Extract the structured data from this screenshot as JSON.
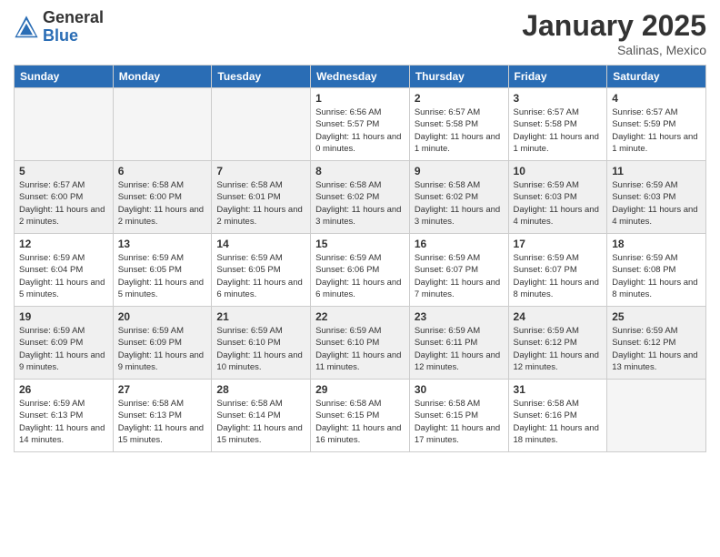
{
  "logo": {
    "general": "General",
    "blue": "Blue"
  },
  "header": {
    "month": "January 2025",
    "location": "Salinas, Mexico"
  },
  "weekdays": [
    "Sunday",
    "Monday",
    "Tuesday",
    "Wednesday",
    "Thursday",
    "Friday",
    "Saturday"
  ],
  "weeks": [
    [
      {
        "day": "",
        "info": "",
        "empty": true
      },
      {
        "day": "",
        "info": "",
        "empty": true
      },
      {
        "day": "",
        "info": "",
        "empty": true
      },
      {
        "day": "1",
        "info": "Sunrise: 6:56 AM\nSunset: 5:57 PM\nDaylight: 11 hours and 0 minutes.",
        "empty": false
      },
      {
        "day": "2",
        "info": "Sunrise: 6:57 AM\nSunset: 5:58 PM\nDaylight: 11 hours and 1 minute.",
        "empty": false
      },
      {
        "day": "3",
        "info": "Sunrise: 6:57 AM\nSunset: 5:58 PM\nDaylight: 11 hours and 1 minute.",
        "empty": false
      },
      {
        "day": "4",
        "info": "Sunrise: 6:57 AM\nSunset: 5:59 PM\nDaylight: 11 hours and 1 minute.",
        "empty": false
      }
    ],
    [
      {
        "day": "5",
        "info": "Sunrise: 6:57 AM\nSunset: 6:00 PM\nDaylight: 11 hours and 2 minutes.",
        "empty": false
      },
      {
        "day": "6",
        "info": "Sunrise: 6:58 AM\nSunset: 6:00 PM\nDaylight: 11 hours and 2 minutes.",
        "empty": false
      },
      {
        "day": "7",
        "info": "Sunrise: 6:58 AM\nSunset: 6:01 PM\nDaylight: 11 hours and 2 minutes.",
        "empty": false
      },
      {
        "day": "8",
        "info": "Sunrise: 6:58 AM\nSunset: 6:02 PM\nDaylight: 11 hours and 3 minutes.",
        "empty": false
      },
      {
        "day": "9",
        "info": "Sunrise: 6:58 AM\nSunset: 6:02 PM\nDaylight: 11 hours and 3 minutes.",
        "empty": false
      },
      {
        "day": "10",
        "info": "Sunrise: 6:59 AM\nSunset: 6:03 PM\nDaylight: 11 hours and 4 minutes.",
        "empty": false
      },
      {
        "day": "11",
        "info": "Sunrise: 6:59 AM\nSunset: 6:03 PM\nDaylight: 11 hours and 4 minutes.",
        "empty": false
      }
    ],
    [
      {
        "day": "12",
        "info": "Sunrise: 6:59 AM\nSunset: 6:04 PM\nDaylight: 11 hours and 5 minutes.",
        "empty": false
      },
      {
        "day": "13",
        "info": "Sunrise: 6:59 AM\nSunset: 6:05 PM\nDaylight: 11 hours and 5 minutes.",
        "empty": false
      },
      {
        "day": "14",
        "info": "Sunrise: 6:59 AM\nSunset: 6:05 PM\nDaylight: 11 hours and 6 minutes.",
        "empty": false
      },
      {
        "day": "15",
        "info": "Sunrise: 6:59 AM\nSunset: 6:06 PM\nDaylight: 11 hours and 6 minutes.",
        "empty": false
      },
      {
        "day": "16",
        "info": "Sunrise: 6:59 AM\nSunset: 6:07 PM\nDaylight: 11 hours and 7 minutes.",
        "empty": false
      },
      {
        "day": "17",
        "info": "Sunrise: 6:59 AM\nSunset: 6:07 PM\nDaylight: 11 hours and 8 minutes.",
        "empty": false
      },
      {
        "day": "18",
        "info": "Sunrise: 6:59 AM\nSunset: 6:08 PM\nDaylight: 11 hours and 8 minutes.",
        "empty": false
      }
    ],
    [
      {
        "day": "19",
        "info": "Sunrise: 6:59 AM\nSunset: 6:09 PM\nDaylight: 11 hours and 9 minutes.",
        "empty": false
      },
      {
        "day": "20",
        "info": "Sunrise: 6:59 AM\nSunset: 6:09 PM\nDaylight: 11 hours and 9 minutes.",
        "empty": false
      },
      {
        "day": "21",
        "info": "Sunrise: 6:59 AM\nSunset: 6:10 PM\nDaylight: 11 hours and 10 minutes.",
        "empty": false
      },
      {
        "day": "22",
        "info": "Sunrise: 6:59 AM\nSunset: 6:10 PM\nDaylight: 11 hours and 11 minutes.",
        "empty": false
      },
      {
        "day": "23",
        "info": "Sunrise: 6:59 AM\nSunset: 6:11 PM\nDaylight: 11 hours and 12 minutes.",
        "empty": false
      },
      {
        "day": "24",
        "info": "Sunrise: 6:59 AM\nSunset: 6:12 PM\nDaylight: 11 hours and 12 minutes.",
        "empty": false
      },
      {
        "day": "25",
        "info": "Sunrise: 6:59 AM\nSunset: 6:12 PM\nDaylight: 11 hours and 13 minutes.",
        "empty": false
      }
    ],
    [
      {
        "day": "26",
        "info": "Sunrise: 6:59 AM\nSunset: 6:13 PM\nDaylight: 11 hours and 14 minutes.",
        "empty": false
      },
      {
        "day": "27",
        "info": "Sunrise: 6:58 AM\nSunset: 6:13 PM\nDaylight: 11 hours and 15 minutes.",
        "empty": false
      },
      {
        "day": "28",
        "info": "Sunrise: 6:58 AM\nSunset: 6:14 PM\nDaylight: 11 hours and 15 minutes.",
        "empty": false
      },
      {
        "day": "29",
        "info": "Sunrise: 6:58 AM\nSunset: 6:15 PM\nDaylight: 11 hours and 16 minutes.",
        "empty": false
      },
      {
        "day": "30",
        "info": "Sunrise: 6:58 AM\nSunset: 6:15 PM\nDaylight: 11 hours and 17 minutes.",
        "empty": false
      },
      {
        "day": "31",
        "info": "Sunrise: 6:58 AM\nSunset: 6:16 PM\nDaylight: 11 hours and 18 minutes.",
        "empty": false
      },
      {
        "day": "",
        "info": "",
        "empty": true
      }
    ]
  ]
}
